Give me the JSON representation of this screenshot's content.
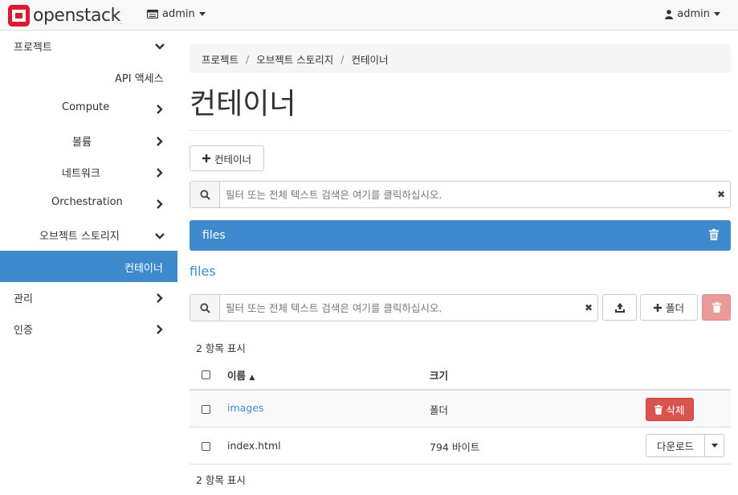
{
  "brand": {
    "name": "openstack",
    "mark": "."
  },
  "topbar": {
    "project": "admin",
    "user": "admin"
  },
  "sidebar": {
    "items": [
      {
        "label": "프로젝트"
      },
      {
        "label": "API 액세스"
      },
      {
        "label": "Compute"
      },
      {
        "label": "볼륨"
      },
      {
        "label": "네트워크"
      },
      {
        "label": "Orchestration"
      },
      {
        "label": "오브젝트 스토리지"
      },
      {
        "label": "컨테이너"
      },
      {
        "label": "관리"
      },
      {
        "label": "인증"
      }
    ]
  },
  "breadcrumb": [
    "프로젝트",
    "오브젝트 스토리지",
    "컨테이너"
  ],
  "page": {
    "title": "컨테이너"
  },
  "toolbar": {
    "add_container": "컨테이너"
  },
  "search": {
    "placeholder": "필터 또는 전체 텍스트 검색은 여기를 클릭하십시오."
  },
  "container": {
    "name": "files"
  },
  "objects": {
    "title": "files",
    "folder_button": "폴더",
    "count_top": "2 항목 표시",
    "count_bottom": "2 항목 표시",
    "columns": {
      "name": "이름",
      "size": "크기"
    },
    "rows": [
      {
        "name": "images",
        "size": "폴더",
        "action": "삭제"
      },
      {
        "name": "index.html",
        "size": "794 바이트",
        "action": "다운로드"
      }
    ]
  },
  "colors": {
    "primary": "#3f8acd",
    "danger": "#d9534f",
    "brand": "#da1a32"
  }
}
